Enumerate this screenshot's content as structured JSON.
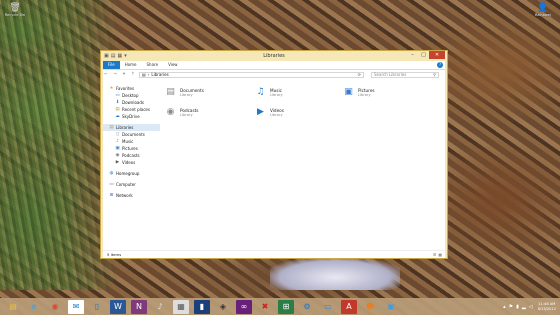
{
  "desktop": {
    "icons": [
      {
        "label": "Recycle Bin"
      },
      {
        "label": "Rainbowj"
      }
    ]
  },
  "window": {
    "title": "Libraries",
    "ribbon_tabs": [
      "File",
      "Home",
      "Share",
      "View"
    ],
    "address": "Libraries",
    "search_placeholder": "Search Libraries",
    "nav": {
      "favorites": {
        "label": "Favorites",
        "items": [
          "Desktop",
          "Downloads",
          "Recent places",
          "SkyDrive"
        ]
      },
      "libraries": {
        "label": "Libraries",
        "items": [
          "Documents",
          "Music",
          "Pictures",
          "Podcasts",
          "Videos"
        ]
      },
      "homegroup": "Homegroup",
      "computer": "Computer",
      "network": "Network"
    },
    "libraries": [
      {
        "name": "Documents",
        "type": "Library"
      },
      {
        "name": "Music",
        "type": "Library"
      },
      {
        "name": "Pictures",
        "type": "Library"
      },
      {
        "name": "Podcasts",
        "type": "Library"
      },
      {
        "name": "Videos",
        "type": "Library"
      }
    ],
    "status": "5 items"
  },
  "taskbar": {
    "apps": [
      "file-explorer",
      "internet-explorer",
      "chrome",
      "outlook",
      "word-doc",
      "word",
      "onenote",
      "music-player",
      "calculator",
      "network-monitor",
      "games",
      "visual-studio",
      "media",
      "windows-store",
      "settings",
      "remote-desktop",
      "acrobat",
      "people",
      "photos"
    ],
    "clock": {
      "time": "11:48 AM",
      "date": "8/13/2012"
    }
  },
  "colors": {
    "accent": "#1979ca",
    "window_frame": "#f6e7b6",
    "close": "#c7432d"
  }
}
